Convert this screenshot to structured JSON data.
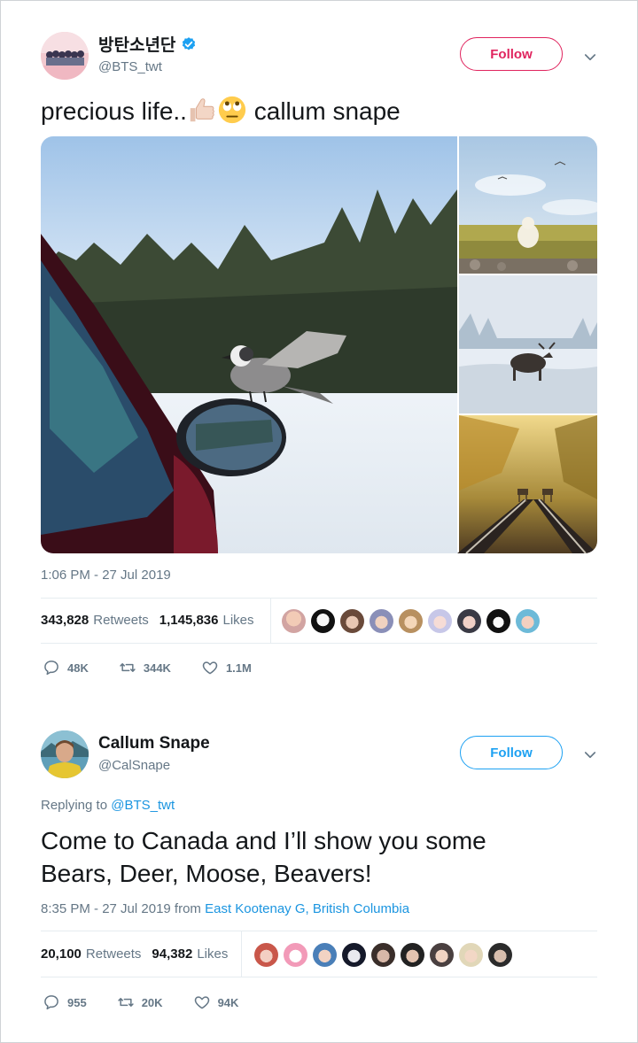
{
  "colors": {
    "accent": "#1da1f2",
    "follow_red": "#e0245e",
    "muted": "#657786"
  },
  "tweet1": {
    "display_name": "방탄소년단",
    "handle": "@BTS_twt",
    "verified": true,
    "follow_label": "Follow",
    "text": "precious life..",
    "text_emojis": [
      "thumbs-up-icon",
      "face-with-rolling-eyes-icon"
    ],
    "text_suffix": " callum snape",
    "media": [
      "bird-on-car-mirror-photo",
      "polar-bear-photo",
      "moose-in-snow-photo",
      "deer-on-railway-photo"
    ],
    "timestamp": "1:06 PM - 27 Jul 2019",
    "retweets_count": "343,828",
    "retweets_label": "Retweets",
    "likes_count": "1,145,836",
    "likes_label": "Likes",
    "likers_count": 9,
    "replies": "48K",
    "retweets_short": "344K",
    "likes_short": "1.1M"
  },
  "tweet2": {
    "display_name": "Callum Snape",
    "handle": "@CalSnape",
    "follow_label": "Follow",
    "replying_prefix": "Replying to ",
    "replying_handle": "@BTS_twt",
    "text_line1": "Come to Canada and I’ll show you some",
    "text_line2": "Bears, Deer, Moose, Beavers!",
    "timestamp": "8:35 PM - 27 Jul 2019 from ",
    "location": "East Kootenay G, British Columbia",
    "retweets_count": "20,100",
    "retweets_label": "Retweets",
    "likes_count": "94,382",
    "likes_label": "Likes",
    "likers_count": 9,
    "replies": "955",
    "retweets_short": "20K",
    "likes_short": "94K"
  }
}
